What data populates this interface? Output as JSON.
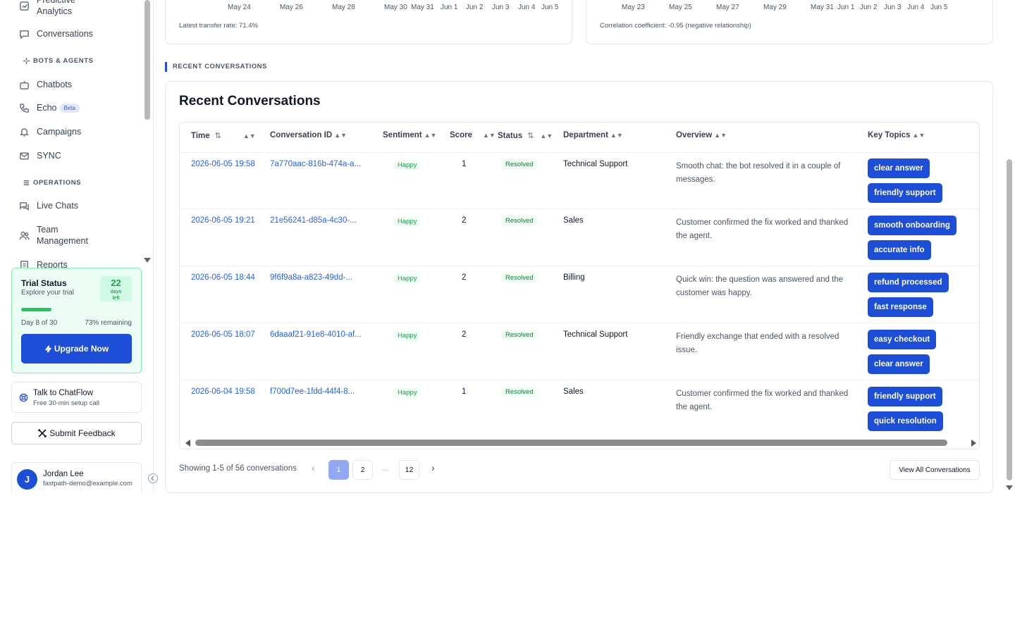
{
  "sidebar": {
    "items_top": [
      {
        "label": "Predictive Analytics",
        "icon": "analytics-icon"
      },
      {
        "label": "Conversations",
        "icon": "chat-bubble-icon"
      }
    ],
    "section_bots": "BOTS & AGENTS",
    "bots_items": [
      {
        "label": "Chatbots",
        "icon": "bot-icon"
      },
      {
        "label": "Echo",
        "icon": "phone-icon",
        "badge": "Beta"
      },
      {
        "label": "Campaigns",
        "icon": "bell-icon"
      },
      {
        "label": "SYNC",
        "icon": "mail-icon"
      }
    ],
    "section_ops": "OPERATIONS",
    "ops_items": [
      {
        "label": "Live Chats",
        "icon": "chats-icon"
      },
      {
        "label": "Team Management",
        "icon": "team-icon"
      },
      {
        "label": "Reports",
        "icon": "reports-icon"
      }
    ],
    "trial": {
      "title": "Trial Status",
      "subtitle": "Explore your trial",
      "days_num": "22",
      "days_label": "days left",
      "progress_fraction": 0.27,
      "day_text": "Day 8 of 30",
      "remaining_text": "73% remaining",
      "upgrade_label": "Upgrade Now"
    },
    "talk": {
      "title": "Talk to ChatFlow",
      "subtitle": "Free 30-min setup call"
    },
    "feedback_label": "Submit Feedback",
    "user": {
      "initial": "J",
      "name": "Jordan Lee",
      "email": "fastpath-demo@example.com"
    }
  },
  "charts": {
    "left_ticks": [
      "May 24",
      "May 26",
      "May 28",
      "May 30",
      "May 31",
      "Jun 1",
      "Jun 2",
      "Jun 3",
      "Jun 4",
      "Jun 5"
    ],
    "left_note": "Latest transfer rate: 71.4%",
    "right_ticks": [
      "May 23",
      "May 25",
      "May 27",
      "May 29",
      "May 31",
      "Jun 1",
      "Jun 2",
      "Jun 3",
      "Jun 4",
      "Jun 5"
    ],
    "right_note": "Correlation coefficient: -0.95 (negative relationship)"
  },
  "recent": {
    "section_label": "RECENT CONVERSATIONS",
    "title": "Recent Conversations",
    "columns": [
      "Time",
      "Conversation ID",
      "Sentiment",
      "Score",
      "Status",
      "Department",
      "Overview",
      "Key Topics"
    ],
    "rows": [
      {
        "time": "2026-06-05 19:58",
        "id": "7a770aac-816b-474a-a...",
        "sentiment": "Happy",
        "score": "1",
        "status": "Resolved",
        "department": "Technical Support",
        "overview": "Smooth chat: the bot resolved it in a couple of messages.",
        "topics": [
          "clear answer",
          "friendly support"
        ]
      },
      {
        "time": "2026-06-05 19:21",
        "id": "21e56241-d85a-4c30-...",
        "sentiment": "Happy",
        "score": "2",
        "status": "Resolved",
        "department": "Sales",
        "overview": "Customer confirmed the fix worked and thanked the agent.",
        "topics": [
          "smooth onboarding",
          "accurate info"
        ]
      },
      {
        "time": "2026-06-05 18:44",
        "id": "9f6f9a8a-a823-49dd-...",
        "sentiment": "Happy",
        "score": "2",
        "status": "Resolved",
        "department": "Billing",
        "overview": "Quick win: the question was answered and the customer was happy.",
        "topics": [
          "refund processed",
          "fast response"
        ]
      },
      {
        "time": "2026-06-05 18:07",
        "id": "6daaaf21-91e8-4010-af...",
        "sentiment": "Happy",
        "score": "2",
        "status": "Resolved",
        "department": "Technical Support",
        "overview": "Friendly exchange that ended with a resolved issue.",
        "topics": [
          "easy checkout",
          "clear answer"
        ]
      },
      {
        "time": "2026-06-04 19:58",
        "id": "f700d7ee-1fdd-44f4-8...",
        "sentiment": "Happy",
        "score": "1",
        "status": "Resolved",
        "department": "Sales",
        "overview": "Customer confirmed the fix worked and thanked the agent.",
        "topics": [
          "friendly support",
          "quick resolution"
        ]
      }
    ],
    "showing": "Showing 1-5 of 56 conversations",
    "pages": [
      "1",
      "2",
      "...",
      "12"
    ],
    "current_page": "1",
    "view_all_label": "View All Conversations"
  }
}
